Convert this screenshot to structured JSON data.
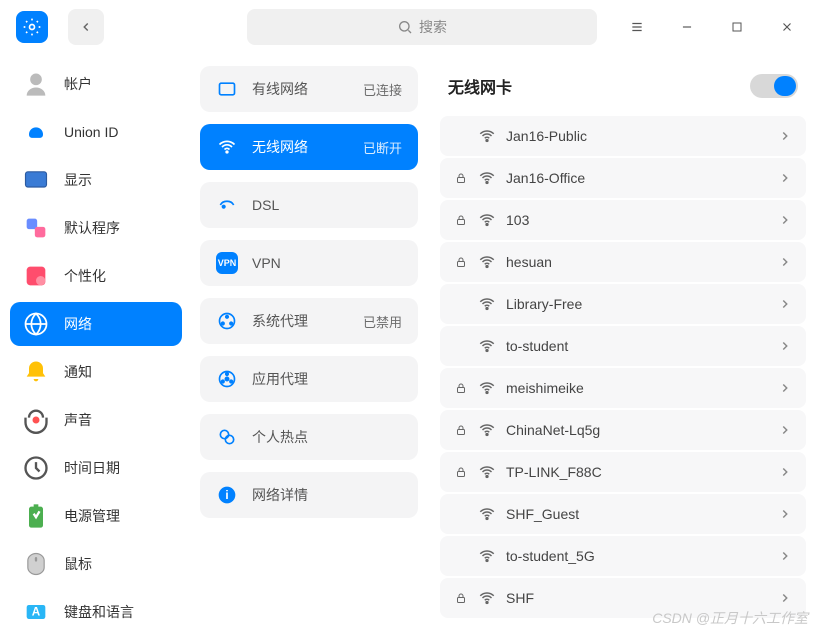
{
  "search": {
    "placeholder": "搜索"
  },
  "sidebar": {
    "items": [
      {
        "label": "帐户"
      },
      {
        "label": "Union ID"
      },
      {
        "label": "显示"
      },
      {
        "label": "默认程序"
      },
      {
        "label": "个性化"
      },
      {
        "label": "网络"
      },
      {
        "label": "通知"
      },
      {
        "label": "声音"
      },
      {
        "label": "时间日期"
      },
      {
        "label": "电源管理"
      },
      {
        "label": "鼠标"
      },
      {
        "label": "键盘和语言"
      }
    ],
    "active": 5
  },
  "network_menu": {
    "items": [
      {
        "label": "有线网络",
        "status": "已连接"
      },
      {
        "label": "无线网络",
        "status": "已断开"
      },
      {
        "label": "DSL",
        "status": ""
      },
      {
        "label": "VPN",
        "status": ""
      },
      {
        "label": "系统代理",
        "status": "已禁用"
      },
      {
        "label": "应用代理",
        "status": ""
      },
      {
        "label": "个人热点",
        "status": ""
      },
      {
        "label": "网络详情",
        "status": ""
      }
    ],
    "active": 1
  },
  "wifi_panel": {
    "title": "无线网卡",
    "enabled": true,
    "networks": [
      {
        "name": "Jan16-Public",
        "locked": false
      },
      {
        "name": "Jan16-Office",
        "locked": true
      },
      {
        "name": "103",
        "locked": true
      },
      {
        "name": "hesuan",
        "locked": true
      },
      {
        "name": "Library-Free",
        "locked": false
      },
      {
        "name": "to-student",
        "locked": false
      },
      {
        "name": "meishimeike",
        "locked": true
      },
      {
        "name": "ChinaNet-Lq5g",
        "locked": true
      },
      {
        "name": "TP-LINK_F88C",
        "locked": true
      },
      {
        "name": "SHF_Guest",
        "locked": false
      },
      {
        "name": "to-student_5G",
        "locked": false
      },
      {
        "name": "SHF",
        "locked": true
      }
    ]
  },
  "watermark": "CSDN @正月十六工作室"
}
